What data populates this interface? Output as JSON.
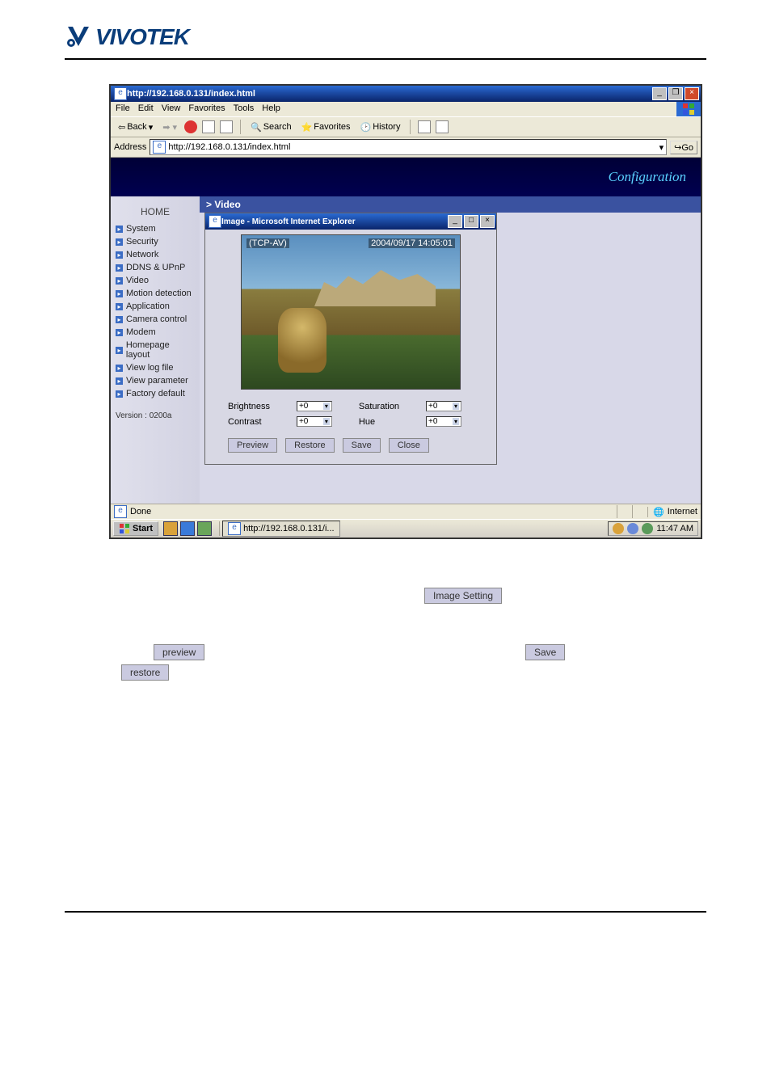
{
  "logo_text": "VIVOTEK",
  "browser": {
    "title": "http://192.168.0.131/index.html",
    "menus": [
      "File",
      "Edit",
      "View",
      "Favorites",
      "Tools",
      "Help"
    ],
    "toolbar": {
      "back": "Back",
      "search": "Search",
      "favorites": "Favorites",
      "history": "History"
    },
    "address_label": "Address",
    "address_value": "http://192.168.0.131/index.html",
    "go": "Go"
  },
  "config_header": "Configuration",
  "sidebar": {
    "home": "HOME",
    "items": [
      "System",
      "Security",
      "Network",
      "DDNS & UPnP",
      "Video",
      "Motion detection",
      "Application",
      "Camera control",
      "Modem",
      "Homepage layout",
      "View log file",
      "View parameter",
      "Factory default"
    ],
    "version": "Version : 0200a"
  },
  "breadcrumb": "> Video",
  "popup": {
    "title": "Image - Microsoft Internet Explorer",
    "overlay_protocol": "(TCP-AV)",
    "overlay_timestamp": "2004/09/17 14:05:01",
    "labels": {
      "brightness": "Brightness",
      "saturation": "Saturation",
      "contrast": "Contrast",
      "hue": "Hue"
    },
    "values": {
      "brightness": "+0",
      "saturation": "+0",
      "contrast": "+0",
      "hue": "+0"
    },
    "buttons": {
      "preview": "Preview",
      "restore": "Restore",
      "save": "Save",
      "close": "Close"
    }
  },
  "statusbar": {
    "done": "Done",
    "zone": "Internet"
  },
  "taskbar": {
    "start": "Start",
    "task": "http://192.168.0.131/i...",
    "time": "11:47 AM"
  },
  "float": {
    "image_setting": "Image Setting",
    "preview": "preview",
    "save": "Save",
    "restore": "restore"
  }
}
